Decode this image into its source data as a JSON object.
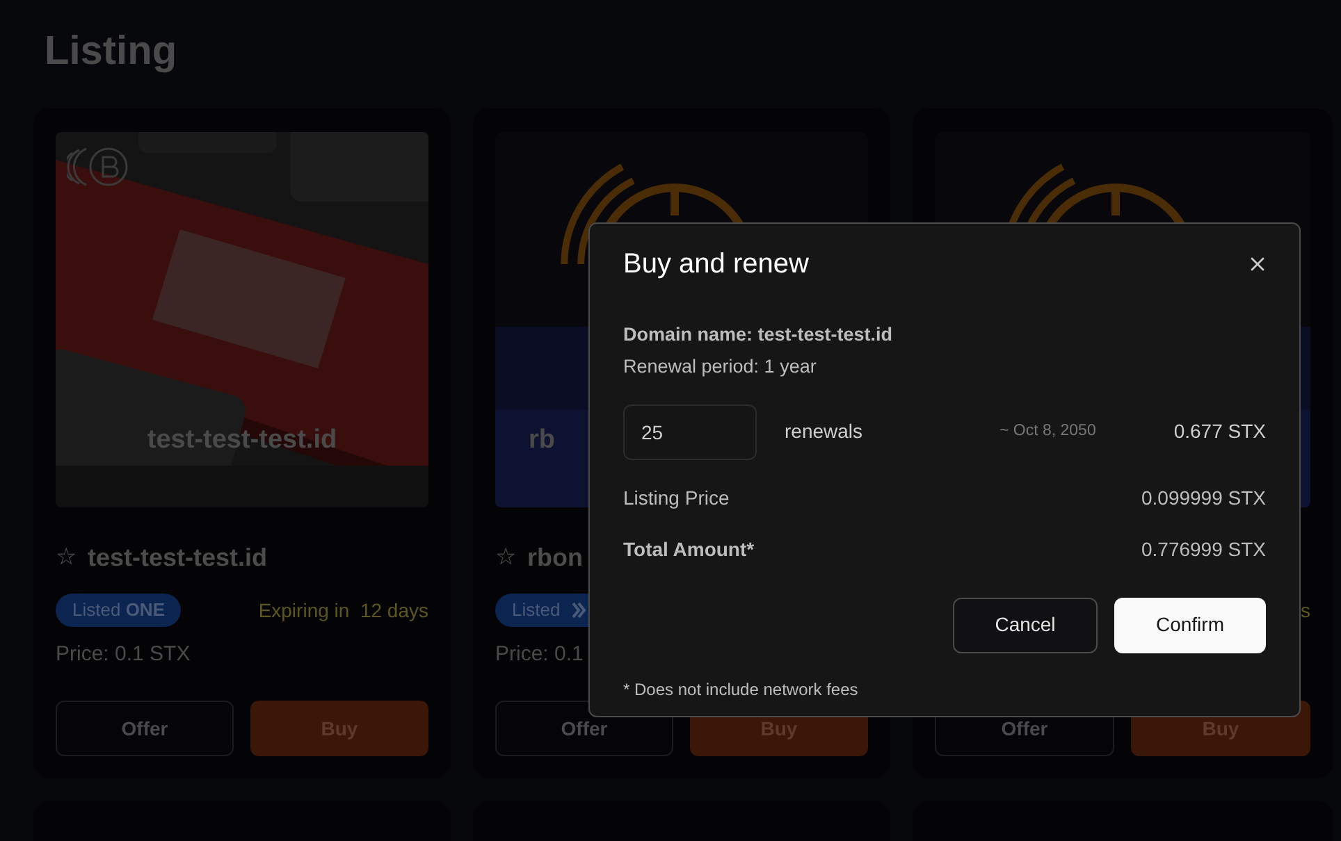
{
  "page_title": "Listing",
  "cards": [
    {
      "image_label": "test-test-test.id",
      "star": "☆",
      "title": "test-test-test.id",
      "badge": {
        "kind": "text",
        "text": "Listed **ONE**"
      },
      "expiry": "Expiring in  12 days",
      "price": "Price: 0.1 STX",
      "buttons": [
        {
          "label": "Offer",
          "kind": "outline"
        },
        {
          "label": "Buy",
          "kind": "primary"
        }
      ]
    },
    {
      "image_label": "rb",
      "star": "☆",
      "title": "rbon",
      "badge": {
        "kind": "icon",
        "text": "Listed"
      },
      "price": "Price: 0.1",
      "buttons": [
        {
          "label": "Offer",
          "kind": "outline"
        },
        {
          "label": "Buy",
          "kind": "primary"
        }
      ]
    },
    {
      "expiry": "s",
      "buttons": [
        {
          "label": "Offer",
          "kind": "outline"
        },
        {
          "label": "Buy",
          "kind": "primary"
        }
      ]
    }
  ],
  "modal": {
    "title": "Buy and renew",
    "domain_name": "Domain name: test-test-test.id",
    "renewal_period": "Renewal period: 1 year",
    "renewals": {
      "value": "25",
      "label": "renewals",
      "until": "~ Oct 8, 2050",
      "amount": "0.677 STX"
    },
    "rows": [
      {
        "label": "Listing Price",
        "value": "0.099999 STX",
        "bold": false
      },
      {
        "label": "Total Amount*",
        "value": "0.776999 STX",
        "bold": true
      }
    ],
    "buttons": [
      {
        "label": "Cancel",
        "kind": "secondary"
      },
      {
        "label": "Confirm",
        "kind": "primary"
      }
    ],
    "footnote": "* Does not include network fees"
  }
}
